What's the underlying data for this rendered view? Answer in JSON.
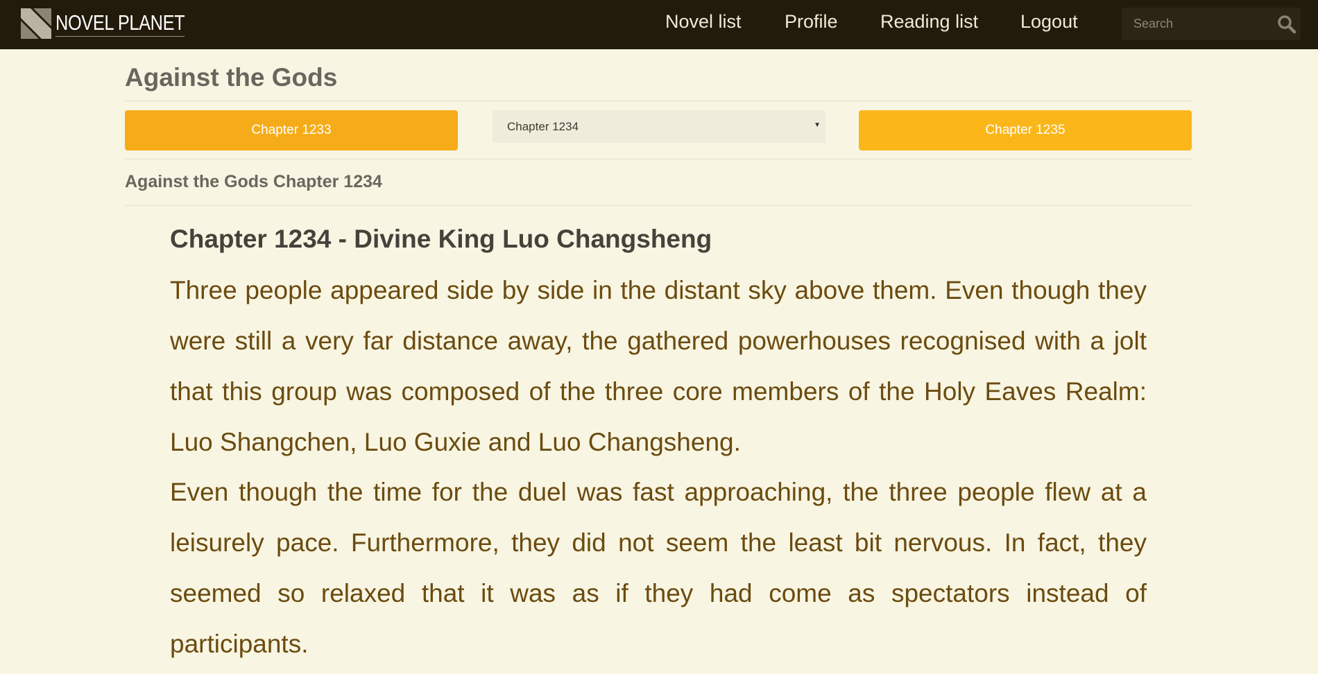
{
  "brand": {
    "logo_text": "NOVEL PLANET"
  },
  "nav": {
    "items": [
      "Novel list",
      "Profile",
      "Reading list",
      "Logout"
    ],
    "search_placeholder": "Search"
  },
  "novel": {
    "title": "Against the Gods"
  },
  "chapter_nav": {
    "prev_label": "Chapter 1233",
    "current_selected": "Chapter 1234",
    "next_label": "Chapter 1235"
  },
  "chapter": {
    "heading": "Against the Gods Chapter 1234",
    "title": "Chapter 1234 - Divine King Luo Changsheng",
    "paragraphs": [
      "Three people appeared side by side in the distant sky above them. Even though they were still a very far distance away, the gathered powerhouses recognised with a jolt that this group was composed of the three core members of the Holy Eaves Realm: Luo Shangchen, Luo Guxie and Luo Changsheng.",
      "Even though the time for the duel was fast approaching, the three people flew at a leisurely pace. Furthermore, they did not seem the least bit nervous. In fact, they seemed so relaxed that it was as if they had come as spectators instead of participants."
    ]
  },
  "colors": {
    "topbar": "#221a0a",
    "page_bg": "#f8f5e2",
    "button_accent": "#f6ac18",
    "body_text": "#6b4b10"
  },
  "icons": {
    "logo": "novel-planet-logo-mark",
    "search": "search-icon"
  }
}
